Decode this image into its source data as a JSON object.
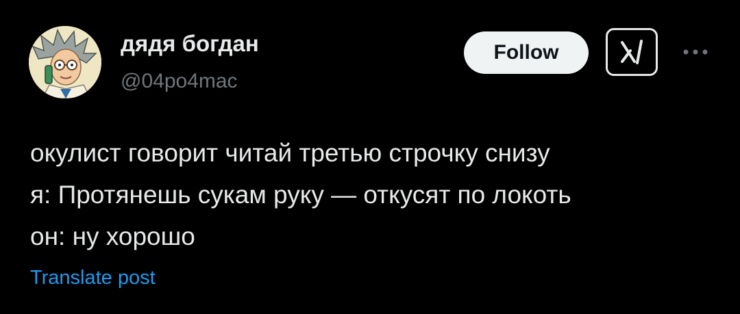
{
  "author": {
    "display_name": "дядя богдан",
    "handle": "@04po4mac",
    "avatar_icon": "cartoon-scientist-avatar"
  },
  "actions": {
    "follow_label": "Follow",
    "grok_icon": "grok-icon",
    "more_icon": "more-dots-icon"
  },
  "post": {
    "lines": [
      "окулист говорит читай третью строчку снизу",
      "я: Протянешь сукам руку — откусят по локоть",
      "он: ну хорошо"
    ],
    "translate_label": "Translate post"
  },
  "colors": {
    "background": "#000000",
    "text_primary": "#e7e9ea",
    "text_secondary": "#71767b",
    "link": "#1d9bf0",
    "follow_bg": "#eff3f4"
  }
}
